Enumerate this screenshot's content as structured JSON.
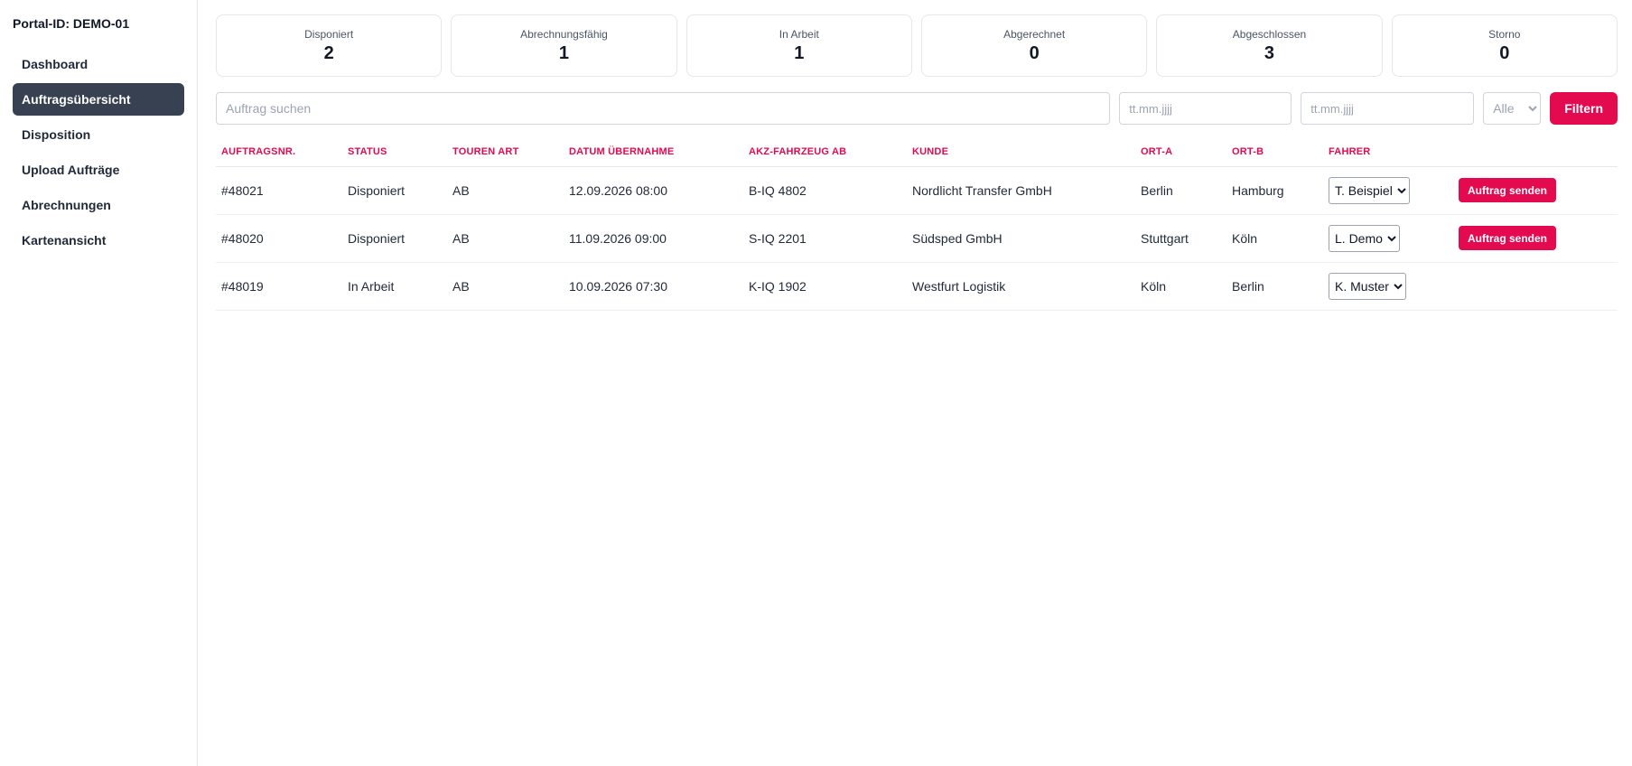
{
  "sidebar": {
    "portal_id": "Portal-ID: DEMO-01",
    "items": [
      {
        "label": "Dashboard"
      },
      {
        "label": "Auftragsübersicht",
        "active": true
      },
      {
        "label": "Disposition"
      },
      {
        "label": "Upload Aufträge"
      },
      {
        "label": "Abrechnungen"
      },
      {
        "label": "Kartenansicht"
      }
    ]
  },
  "stats": [
    {
      "label": "Disponiert",
      "value": "2"
    },
    {
      "label": "Abrechnungsfähig",
      "value": "1"
    },
    {
      "label": "In Arbeit",
      "value": "1"
    },
    {
      "label": "Abgerechnet",
      "value": "0"
    },
    {
      "label": "Abgeschlossen",
      "value": "3"
    },
    {
      "label": "Storno",
      "value": "0"
    }
  ],
  "filters": {
    "search_placeholder": "Auftrag suchen",
    "date_from_placeholder": "tt.mm.jjjj",
    "date_to_placeholder": "tt.mm.jjjj",
    "status_selected": "Alle",
    "filter_label": "Filtern"
  },
  "table": {
    "headers": [
      "Auftragsnr.",
      "Status",
      "Touren Art",
      "Datum Übernahme",
      "AKZ-Fahrzeug AB",
      "Kunde",
      "Ort-A",
      "Ort-B",
      "Fahrer"
    ],
    "send_label": "Auftrag senden",
    "rows": [
      {
        "nr": "#48021",
        "status": "Disponiert",
        "tour": "AB",
        "datum": "12.09.2026 08:00",
        "akz": "B-IQ 4802",
        "kunde": "Nordlicht Transfer GmbH",
        "orta": "Berlin",
        "ortb": "Hamburg",
        "fahrer": "T. Beispiel",
        "send": true
      },
      {
        "nr": "#48020",
        "status": "Disponiert",
        "tour": "AB",
        "datum": "11.09.2026 09:00",
        "akz": "S-IQ 2201",
        "kunde": "Südsped GmbH",
        "orta": "Stuttgart",
        "ortb": "Köln",
        "fahrer": "L. Demo",
        "send": true
      },
      {
        "nr": "#48019",
        "status": "In Arbeit",
        "tour": "AB",
        "datum": "10.09.2026 07:30",
        "akz": "K-IQ 1902",
        "kunde": "Westfurt Logistik",
        "orta": "Köln",
        "ortb": "Berlin",
        "fahrer": "K. Muster",
        "send": false
      }
    ]
  },
  "colors": {
    "accent": "#e30a4f",
    "sidebar_active": "#374151"
  }
}
